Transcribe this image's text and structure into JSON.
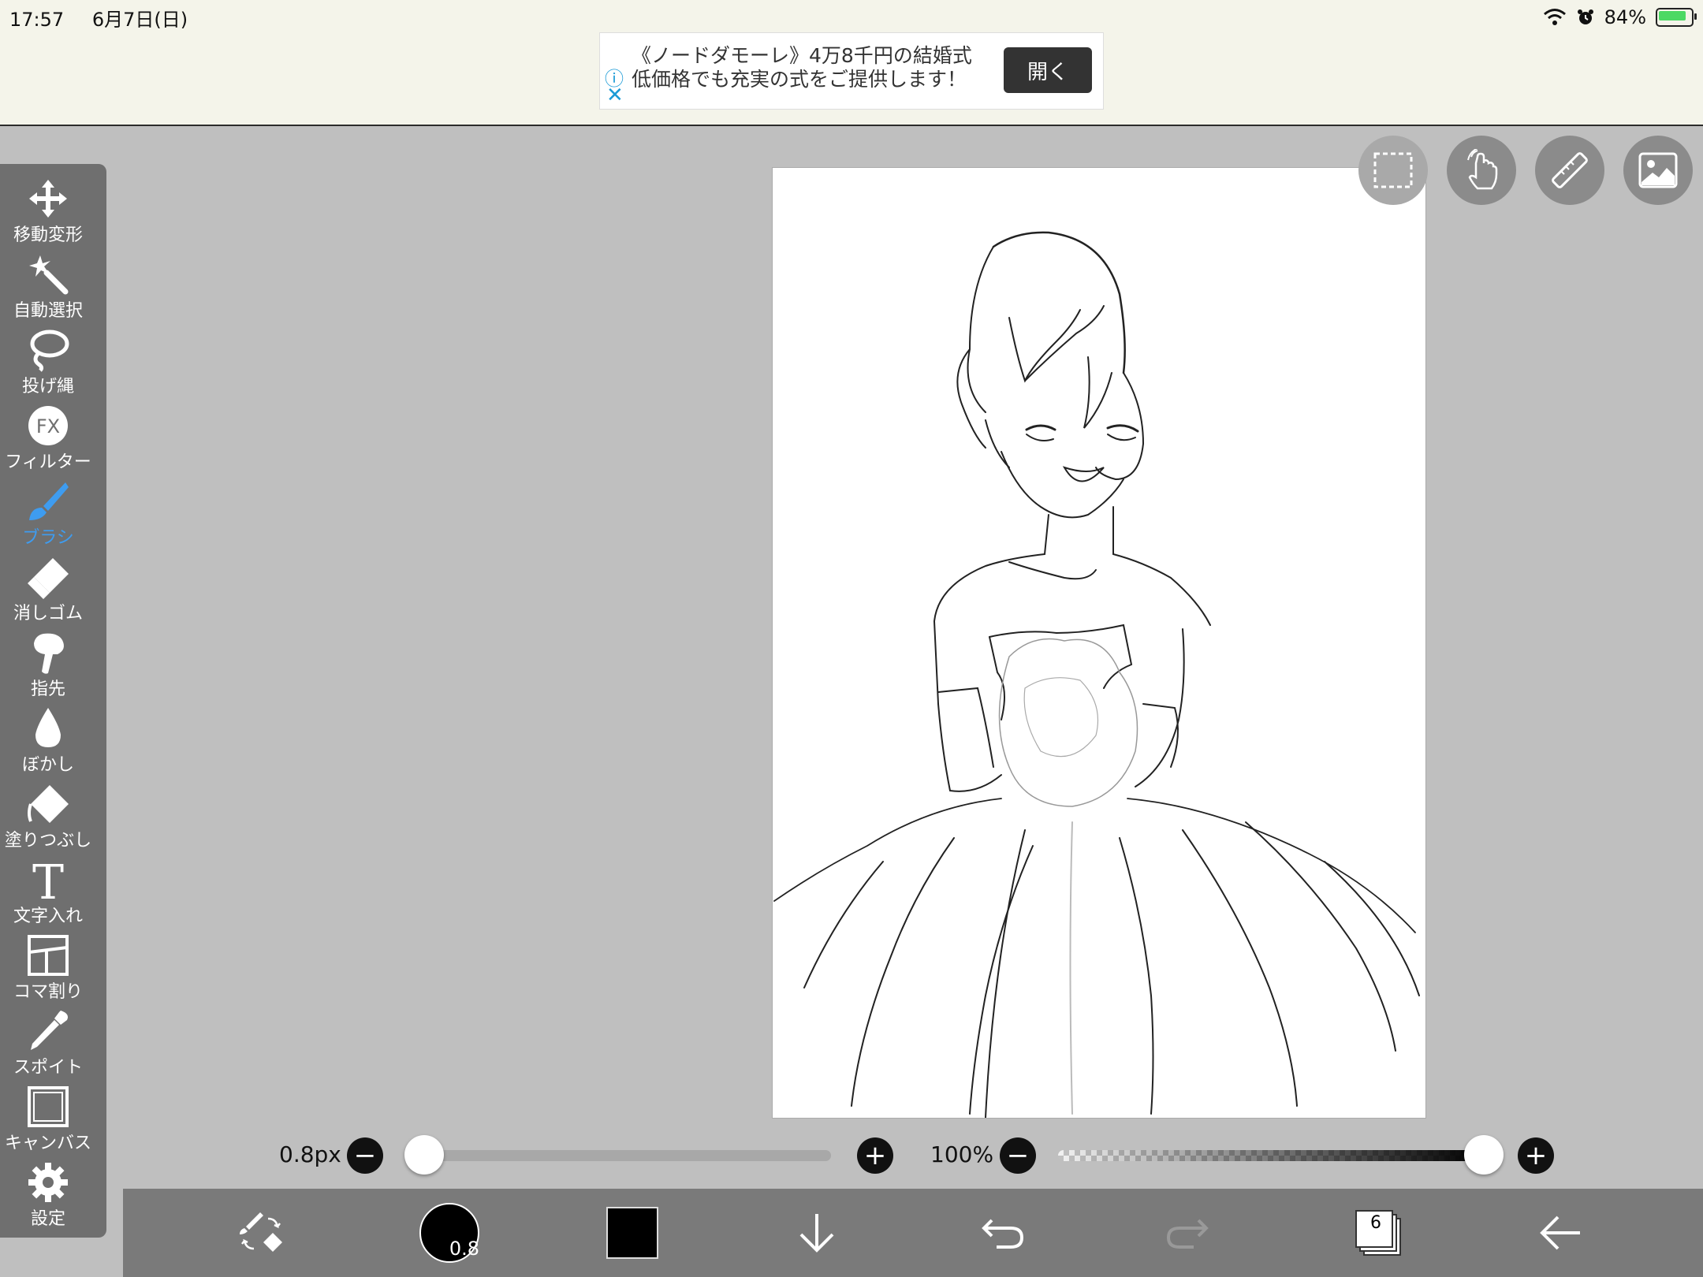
{
  "status": {
    "time": "17:57",
    "date": "6月7日(日)",
    "battery": "84%",
    "battery_level": 0.84,
    "icons": [
      "wifi-icon",
      "alarm-icon",
      "battery-icon"
    ]
  },
  "ad": {
    "line1": "《ノードダモーレ》4万8千円の結婚式",
    "line2": "低価格でも充実の式をご提供します！",
    "open_label": "開く",
    "info_glyph": "ⓘ",
    "close_glyph": "✕"
  },
  "tools": [
    {
      "id": "move",
      "label": "移動変形",
      "icon": "move-icon"
    },
    {
      "id": "auto-select",
      "label": "自動選択",
      "icon": "magic-wand-icon"
    },
    {
      "id": "lasso",
      "label": "投げ縄",
      "icon": "lasso-icon"
    },
    {
      "id": "filter",
      "label": "フィルター",
      "icon": "fx-icon",
      "glyph": "FX"
    },
    {
      "id": "brush",
      "label": "ブラシ",
      "icon": "brush-icon",
      "active": true
    },
    {
      "id": "eraser",
      "label": "消しゴム",
      "icon": "eraser-icon"
    },
    {
      "id": "finger",
      "label": "指先",
      "icon": "finger-icon"
    },
    {
      "id": "blur",
      "label": "ぼかし",
      "icon": "drop-icon"
    },
    {
      "id": "fill",
      "label": "塗りつぶし",
      "icon": "bucket-icon"
    },
    {
      "id": "text",
      "label": "文字入れ",
      "icon": "text-icon",
      "glyph": "T"
    },
    {
      "id": "frame",
      "label": "コマ割り",
      "icon": "frame-icon"
    },
    {
      "id": "eyedropper",
      "label": "スポイト",
      "icon": "eyedropper-icon"
    },
    {
      "id": "canvas",
      "label": "キャンバス",
      "icon": "canvas-icon"
    },
    {
      "id": "settings",
      "label": "設定",
      "icon": "gear-icon"
    }
  ],
  "colors": {
    "active_tool": "#3e9cf0",
    "current_color": "#000000"
  },
  "sliders": {
    "size_label": "0.8px",
    "size_value": 0.0,
    "opacity_label": "100%",
    "opacity_value": 1.0
  },
  "bottom": {
    "brush_size": "0.8",
    "layer_count": "6"
  }
}
